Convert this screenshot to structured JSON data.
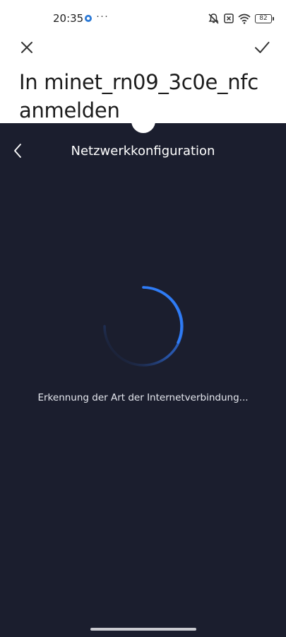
{
  "status_bar": {
    "time": "20:35",
    "more_indicator": "···",
    "battery_level": "82",
    "icons": [
      "app-notification-icon",
      "muted-bell-icon",
      "no-sim-icon",
      "wifi-icon",
      "battery-icon"
    ]
  },
  "dialog": {
    "close_icon": "close-icon",
    "confirm_icon": "check-icon",
    "title": "In minet_rn09_3c0e_nfc anmelden"
  },
  "webview": {
    "back_icon": "chevron-left-icon",
    "page_title": "Netzwerkkonfiguration",
    "status_text": "Erkennung der Art der Internetverbindung...",
    "background_color": "#1b1e2e",
    "spinner_color": "#2f7cf6"
  }
}
